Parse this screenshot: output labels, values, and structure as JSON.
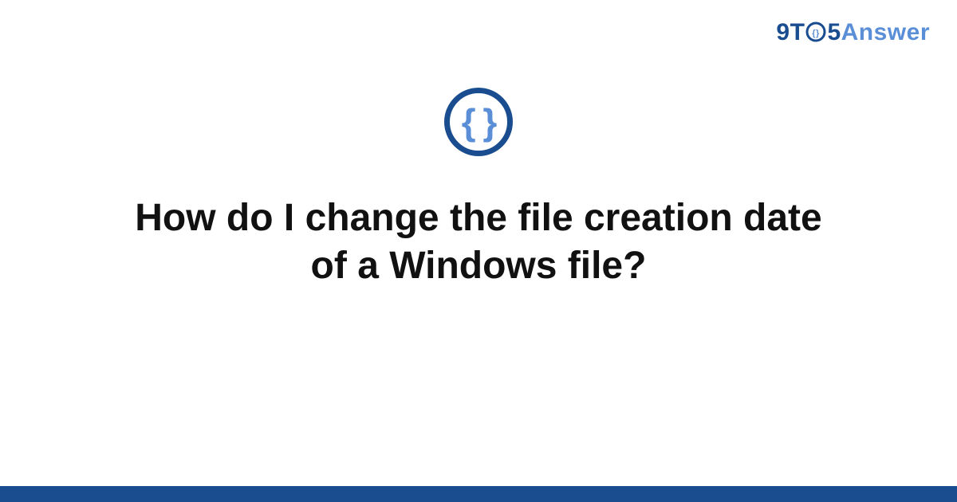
{
  "brand": {
    "part_9": "9",
    "part_T": "T",
    "part_5": "5",
    "part_answer": "Answer"
  },
  "icon": {
    "glyph": "{ }"
  },
  "title": "How do I change the file creation date of a Windows file?",
  "colors": {
    "primary": "#1a4d8f",
    "accent": "#5a8fd8"
  }
}
